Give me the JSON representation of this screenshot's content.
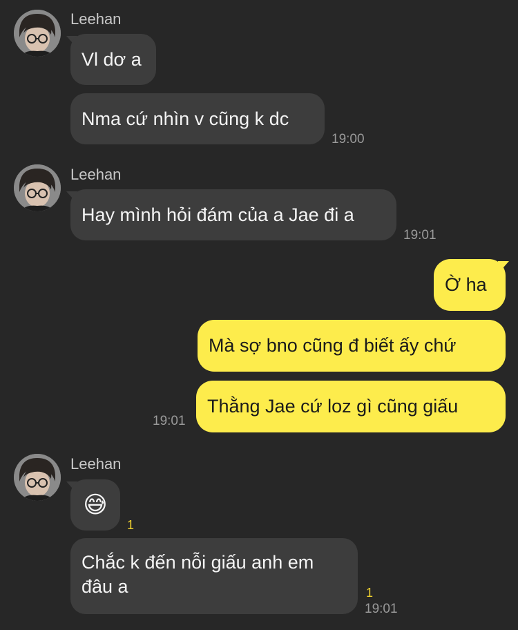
{
  "groups": [
    {
      "sender": "Leehan",
      "messages": [
        {
          "text": "Vl dơ a"
        },
        {
          "text": "Nma cứ nhìn v cũng k dc",
          "time": "19:00"
        }
      ]
    },
    {
      "sender": "Leehan",
      "messages": [
        {
          "text": "Hay mình hỏi đám của a Jae đi a",
          "time": "19:01"
        }
      ]
    },
    {
      "sender": "me",
      "messages": [
        {
          "text": "Ờ ha"
        },
        {
          "text": "Mà sợ bno cũng đ biết ấy chứ"
        },
        {
          "text": "Thằng Jae cứ loz gì cũng giấu",
          "time": "19:01"
        }
      ]
    },
    {
      "sender": "Leehan",
      "messages": [
        {
          "text": "😅",
          "unread": "1"
        },
        {
          "text": "Chắc k đến nỗi giấu anh em đâu a",
          "unread": "1",
          "time": "19:01"
        }
      ]
    }
  ],
  "icons": {
    "avatar": "user-photo-avatar"
  },
  "colors": {
    "background": "#272727",
    "incoming_bubble": "#3d3d3d",
    "outgoing_bubble": "#fdec4c",
    "unread_count": "#f1d22f"
  }
}
